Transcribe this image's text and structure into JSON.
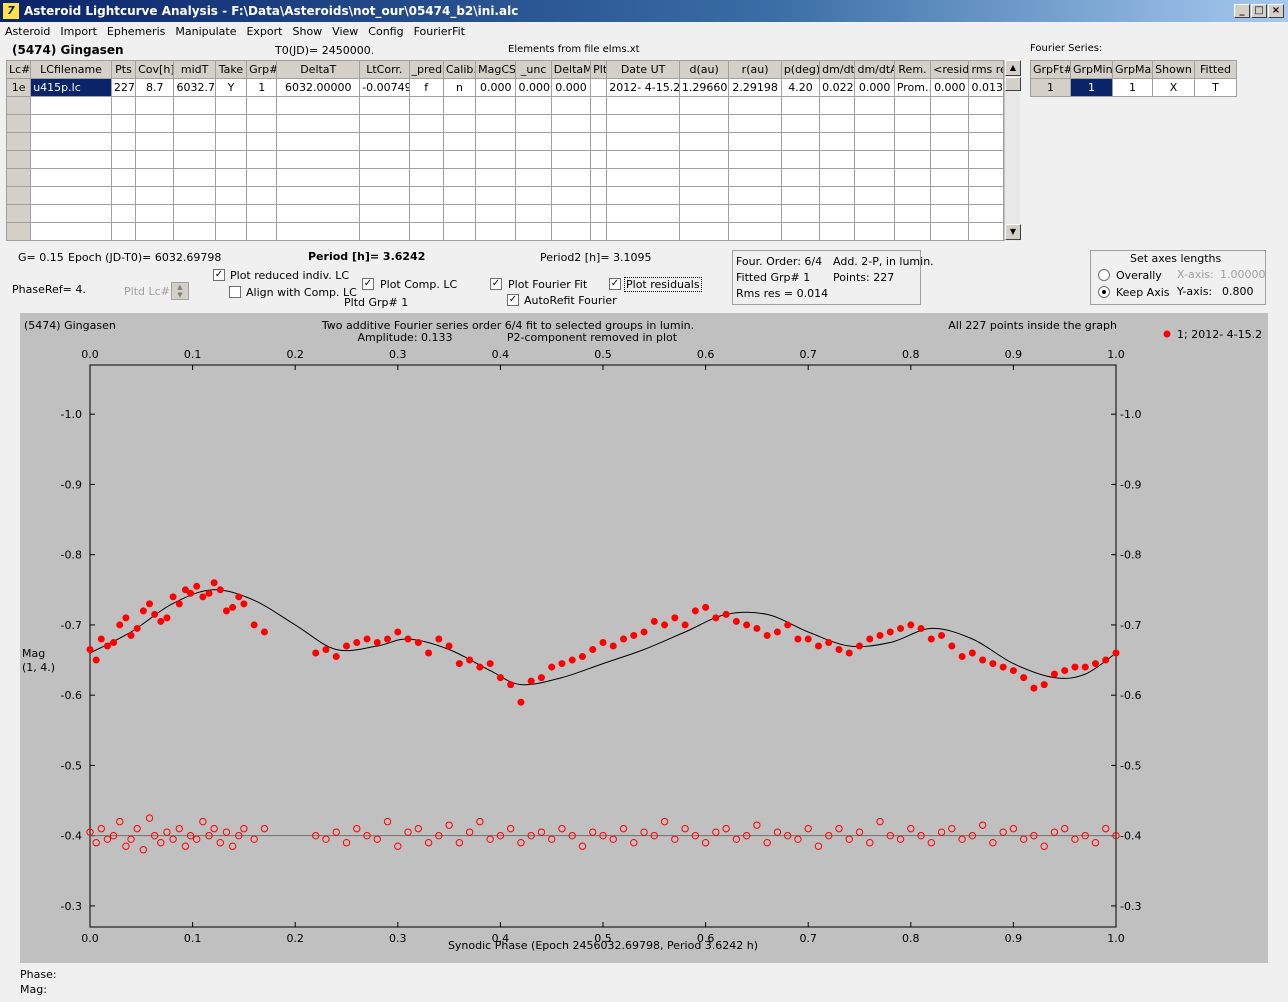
{
  "window": {
    "title": "Asteroid Lightcurve Analysis - F:\\Data\\Asteroids\\not_our\\05474_b2\\ini.alc"
  },
  "menu": [
    "Asteroid",
    "Import",
    "Ephemeris",
    "Manipulate",
    "Export",
    "Show",
    "View",
    "Config",
    "FourierFit"
  ],
  "header": {
    "asteroid": "(5474) Gingasen",
    "t0": "T0(JD)= 2450000.",
    "elements": "Elements from file elms.xt",
    "fourier_label": "Fourier Series:"
  },
  "lc_table": {
    "columns": [
      "Lc#",
      "LCfilename",
      "Pts",
      "Cov[h]",
      "midT",
      "Take",
      "Grp#",
      "DeltaT",
      "LtCorr.",
      "_pred.",
      "Calib.",
      "MagCS",
      "_unc",
      "DeltaM",
      "Plt",
      "Date UT",
      "d(au)",
      "r(au)",
      "p(deg)",
      "dm/dt",
      "dm/dtA",
      "Rem.",
      "<resid>",
      "rms res"
    ],
    "rows": [
      [
        "1e",
        "u415p.lc",
        "227",
        "8.7",
        "6032.7",
        "Y",
        "1",
        "6032.00000",
        "-0.00749",
        "f",
        "n",
        "0.000",
        "0.000",
        "0.000",
        "",
        "2012- 4-15.2",
        "1.29660",
        "2.29198",
        "4.20",
        "0.022",
        "0.000",
        "Prom...",
        "0.000",
        "0.013"
      ]
    ],
    "empty_rows": 8
  },
  "fourier_table": {
    "columns": [
      "GrpFt#",
      "GrpMin",
      "GrpMax",
      "Shown",
      "Fitted"
    ],
    "row": [
      "1",
      "1",
      "1",
      "X",
      "T"
    ]
  },
  "info": {
    "g": "G= 0.15",
    "epoch": "Epoch (JD-T0)= 6032.69798",
    "period": "Period [h]= 3.6242",
    "period2": "Period2 [h]= 3.1095",
    "phaseref": "PhaseRef= 4.",
    "pltd_lc": "Pltd Lc#:",
    "pltd_grp": "Pltd Grp#  1"
  },
  "checkboxes": {
    "plot_reduced": {
      "label": "Plot reduced indiv. LC",
      "checked": true
    },
    "align_comp": {
      "label": "Align with Comp. LC",
      "checked": false
    },
    "plot_comp": {
      "label": "Plot Comp. LC",
      "checked": true
    },
    "plot_fourier": {
      "label": "Plot Fourier Fit",
      "checked": true
    },
    "autorefit": {
      "label": "AutoRefit Fourier",
      "checked": true
    },
    "plot_residuals": {
      "label": "Plot residuals",
      "checked": true
    }
  },
  "fourier_info": {
    "order": "Four. Order:  6/4",
    "add": "Add. 2-P, in lumin.",
    "fitted": "Fitted Grp# 1",
    "points": "Points: 227",
    "rms": "Rms res     = 0.014"
  },
  "axes_box": {
    "title": "Set axes lengths",
    "overally": "Overally",
    "keep_axis": "Keep Axis",
    "xaxis_label": "X-axis:",
    "xaxis_value": "1.00000",
    "yaxis_label": "Y-axis:",
    "yaxis_value": "0.800"
  },
  "status": {
    "phase": "Phase:",
    "mag": "Mag:"
  },
  "colors": {
    "data": "#ff0000",
    "plot_bg": "#c0c0c0",
    "fit_line": "#000000",
    "selection": "#0a246a"
  },
  "chart_data": {
    "type": "scatter",
    "title_left": "(5474) Gingasen",
    "title_center_1": "Two additive Fourier series order 6/4 fit to selected groups in lumin.",
    "title_center_2": "Amplitude: 0.133",
    "title_center_3": "P2-component removed in plot",
    "title_right": "All 227 points inside the graph",
    "legend": "1; 2012- 4-15.2",
    "xlabel": "Synodic Phase (Epoch 2456032.69798, Period 3.6242 h)",
    "ylabel_1": "Mag",
    "ylabel_2": "(1, 4.)",
    "xlim": [
      0.0,
      1.0
    ],
    "ylim": [
      -1.07,
      -0.27
    ],
    "y_inverted": true,
    "x_ticks": [
      "0.0",
      "0.1",
      "0.2",
      "0.3",
      "0.4",
      "0.5",
      "0.6",
      "0.7",
      "0.8",
      "0.9",
      "1.0"
    ],
    "y_ticks": [
      "-1.0",
      "-0.9",
      "-0.8",
      "-0.7",
      "-0.6",
      "-0.5",
      "-0.4",
      "-0.3"
    ],
    "residual_baseline": -0.4,
    "fit_curve": {
      "x": [
        0.0,
        0.04,
        0.08,
        0.12,
        0.16,
        0.2,
        0.24,
        0.28,
        0.31,
        0.35,
        0.39,
        0.42,
        0.46,
        0.5,
        0.54,
        0.58,
        0.62,
        0.66,
        0.7,
        0.74,
        0.78,
        0.82,
        0.86,
        0.9,
        0.94,
        0.97,
        1.0
      ],
      "y": [
        -0.66,
        -0.69,
        -0.73,
        -0.75,
        -0.735,
        -0.7,
        -0.665,
        -0.67,
        -0.68,
        -0.665,
        -0.635,
        -0.615,
        -0.625,
        -0.645,
        -0.665,
        -0.69,
        -0.715,
        -0.715,
        -0.69,
        -0.67,
        -0.675,
        -0.695,
        -0.68,
        -0.645,
        -0.625,
        -0.63,
        -0.66
      ]
    },
    "points": {
      "x": [
        0.0,
        0.006,
        0.011,
        0.017,
        0.023,
        0.029,
        0.035,
        0.04,
        0.046,
        0.052,
        0.058,
        0.063,
        0.069,
        0.075,
        0.081,
        0.087,
        0.093,
        0.098,
        0.104,
        0.11,
        0.116,
        0.121,
        0.127,
        0.133,
        0.139,
        0.145,
        0.15,
        0.16,
        0.17,
        0.22,
        0.23,
        0.24,
        0.25,
        0.26,
        0.27,
        0.28,
        0.29,
        0.3,
        0.31,
        0.32,
        0.33,
        0.34,
        0.35,
        0.36,
        0.37,
        0.38,
        0.39,
        0.4,
        0.41,
        0.42,
        0.43,
        0.44,
        0.45,
        0.46,
        0.47,
        0.48,
        0.49,
        0.5,
        0.51,
        0.52,
        0.53,
        0.54,
        0.55,
        0.56,
        0.57,
        0.58,
        0.59,
        0.6,
        0.61,
        0.62,
        0.63,
        0.64,
        0.65,
        0.66,
        0.67,
        0.68,
        0.69,
        0.7,
        0.71,
        0.72,
        0.73,
        0.74,
        0.75,
        0.76,
        0.77,
        0.78,
        0.79,
        0.8,
        0.81,
        0.82,
        0.83,
        0.84,
        0.85,
        0.86,
        0.87,
        0.88,
        0.89,
        0.9,
        0.91,
        0.92,
        0.93,
        0.94,
        0.95,
        0.96,
        0.97,
        0.98,
        0.99,
        1.0
      ],
      "y": [
        -0.665,
        -0.65,
        -0.68,
        -0.67,
        -0.675,
        -0.7,
        -0.71,
        -0.685,
        -0.695,
        -0.72,
        -0.73,
        -0.715,
        -0.705,
        -0.71,
        -0.74,
        -0.73,
        -0.75,
        -0.745,
        -0.755,
        -0.74,
        -0.745,
        -0.76,
        -0.75,
        -0.72,
        -0.725,
        -0.74,
        -0.73,
        -0.7,
        -0.69,
        -0.66,
        -0.665,
        -0.655,
        -0.67,
        -0.675,
        -0.68,
        -0.675,
        -0.68,
        -0.69,
        -0.68,
        -0.675,
        -0.66,
        -0.68,
        -0.67,
        -0.645,
        -0.65,
        -0.64,
        -0.645,
        -0.625,
        -0.615,
        -0.59,
        -0.62,
        -0.625,
        -0.64,
        -0.645,
        -0.65,
        -0.655,
        -0.665,
        -0.675,
        -0.67,
        -0.68,
        -0.685,
        -0.69,
        -0.705,
        -0.7,
        -0.71,
        -0.7,
        -0.72,
        -0.725,
        -0.71,
        -0.715,
        -0.705,
        -0.7,
        -0.695,
        -0.685,
        -0.69,
        -0.7,
        -0.68,
        -0.68,
        -0.67,
        -0.675,
        -0.665,
        -0.66,
        -0.67,
        -0.68,
        -0.685,
        -0.69,
        -0.695,
        -0.7,
        -0.695,
        -0.68,
        -0.685,
        -0.67,
        -0.655,
        -0.66,
        -0.65,
        -0.645,
        -0.64,
        -0.635,
        -0.625,
        -0.61,
        -0.615,
        -0.63,
        -0.635,
        -0.64,
        -0.64,
        -0.645,
        -0.65,
        -0.66
      ]
    },
    "residuals": {
      "x": [
        0.0,
        0.006,
        0.011,
        0.017,
        0.023,
        0.029,
        0.035,
        0.04,
        0.046,
        0.052,
        0.058,
        0.063,
        0.069,
        0.075,
        0.081,
        0.087,
        0.093,
        0.098,
        0.104,
        0.11,
        0.116,
        0.121,
        0.127,
        0.133,
        0.139,
        0.145,
        0.15,
        0.16,
        0.17,
        0.22,
        0.23,
        0.24,
        0.25,
        0.26,
        0.27,
        0.28,
        0.29,
        0.3,
        0.31,
        0.32,
        0.33,
        0.34,
        0.35,
        0.36,
        0.37,
        0.38,
        0.39,
        0.4,
        0.41,
        0.42,
        0.43,
        0.44,
        0.45,
        0.46,
        0.47,
        0.48,
        0.49,
        0.5,
        0.51,
        0.52,
        0.53,
        0.54,
        0.55,
        0.56,
        0.57,
        0.58,
        0.59,
        0.6,
        0.61,
        0.62,
        0.63,
        0.64,
        0.65,
        0.66,
        0.67,
        0.68,
        0.69,
        0.7,
        0.71,
        0.72,
        0.73,
        0.74,
        0.75,
        0.76,
        0.77,
        0.78,
        0.79,
        0.8,
        0.81,
        0.82,
        0.83,
        0.84,
        0.85,
        0.86,
        0.87,
        0.88,
        0.89,
        0.9,
        0.91,
        0.92,
        0.93,
        0.94,
        0.95,
        0.96,
        0.97,
        0.98,
        0.99,
        1.0
      ],
      "y": [
        -0.405,
        -0.39,
        -0.41,
        -0.395,
        -0.4,
        -0.42,
        -0.385,
        -0.395,
        -0.41,
        -0.38,
        -0.425,
        -0.4,
        -0.39,
        -0.405,
        -0.395,
        -0.41,
        -0.385,
        -0.4,
        -0.395,
        -0.42,
        -0.4,
        -0.41,
        -0.39,
        -0.405,
        -0.385,
        -0.4,
        -0.41,
        -0.395,
        -0.41,
        -0.4,
        -0.395,
        -0.405,
        -0.39,
        -0.41,
        -0.4,
        -0.395,
        -0.42,
        -0.385,
        -0.405,
        -0.41,
        -0.39,
        -0.4,
        -0.415,
        -0.39,
        -0.405,
        -0.42,
        -0.395,
        -0.4,
        -0.41,
        -0.39,
        -0.4,
        -0.405,
        -0.395,
        -0.41,
        -0.4,
        -0.385,
        -0.405,
        -0.4,
        -0.395,
        -0.41,
        -0.39,
        -0.405,
        -0.4,
        -0.42,
        -0.395,
        -0.41,
        -0.4,
        -0.39,
        -0.405,
        -0.41,
        -0.395,
        -0.4,
        -0.415,
        -0.39,
        -0.405,
        -0.4,
        -0.395,
        -0.41,
        -0.385,
        -0.4,
        -0.41,
        -0.395,
        -0.405,
        -0.39,
        -0.42,
        -0.4,
        -0.395,
        -0.41,
        -0.4,
        -0.39,
        -0.405,
        -0.41,
        -0.395,
        -0.4,
        -0.415,
        -0.39,
        -0.405,
        -0.41,
        -0.395,
        -0.4,
        -0.385,
        -0.405,
        -0.41,
        -0.395,
        -0.4,
        -0.39,
        -0.41,
        -0.4
      ]
    }
  }
}
